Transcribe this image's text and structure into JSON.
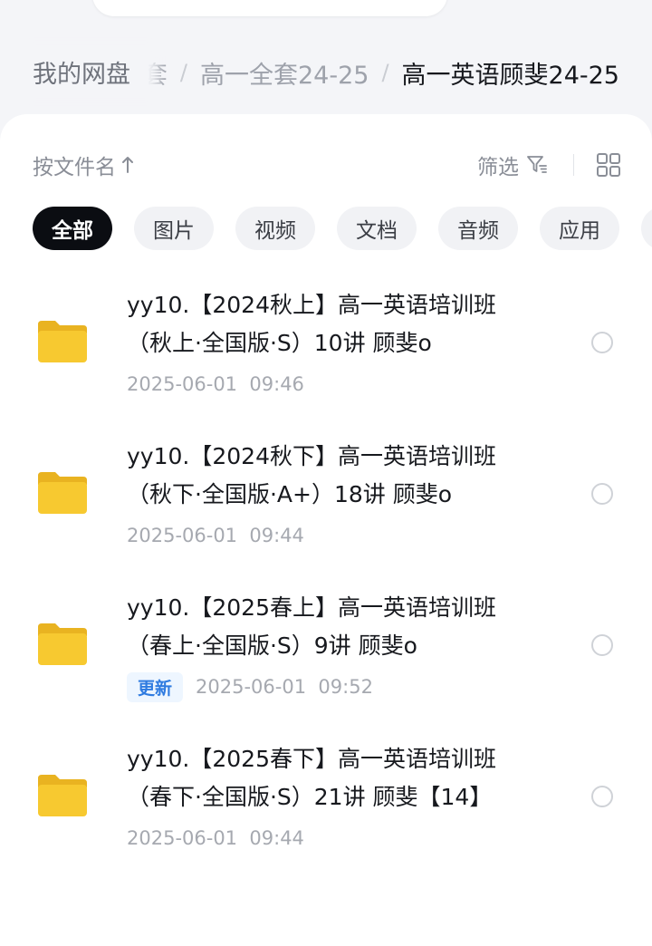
{
  "breadcrumb": {
    "root": "我的网盘",
    "items": [
      "套",
      "高一全套24-25"
    ],
    "current": "高一英语顾斐24-25"
  },
  "toolbar": {
    "sort_label": "按文件名",
    "filter_label": "筛选"
  },
  "chips": [
    {
      "label": "全部",
      "active": true
    },
    {
      "label": "图片"
    },
    {
      "label": "视频"
    },
    {
      "label": "文档"
    },
    {
      "label": "音频"
    },
    {
      "label": "应用"
    }
  ],
  "files": [
    {
      "name_line1": "yy10.【2024秋上】高一英语培训班",
      "name_line2": "（秋上·全国版·S）10讲 顾斐o",
      "date": "2025-06-01  09:46"
    },
    {
      "name_line1": "yy10.【2024秋下】高一英语培训班",
      "name_line2": "（秋下·全国版·A+）18讲 顾斐o",
      "date": "2025-06-01  09:44"
    },
    {
      "name_line1": "yy10.【2025春上】高一英语培训班",
      "name_line2": "（春上·全国版·S）9讲 顾斐o",
      "badge": "更新",
      "date": "2025-06-01  09:52"
    },
    {
      "name_line1": "yy10.【2025春下】高一英语培训班",
      "name_line2": "（春下·全国版·S）21讲 顾斐【14】",
      "date": "2025-06-01  09:44"
    }
  ],
  "colors": {
    "folder": "#f7c930",
    "active_chip": "#0b0d12",
    "badge_text": "#2f7be0"
  },
  "icons": {
    "sort": "arrow-up-icon",
    "filter": "filter-icon",
    "view": "grid-view-icon",
    "file": "folder-icon",
    "select": "radio-circle-icon"
  }
}
